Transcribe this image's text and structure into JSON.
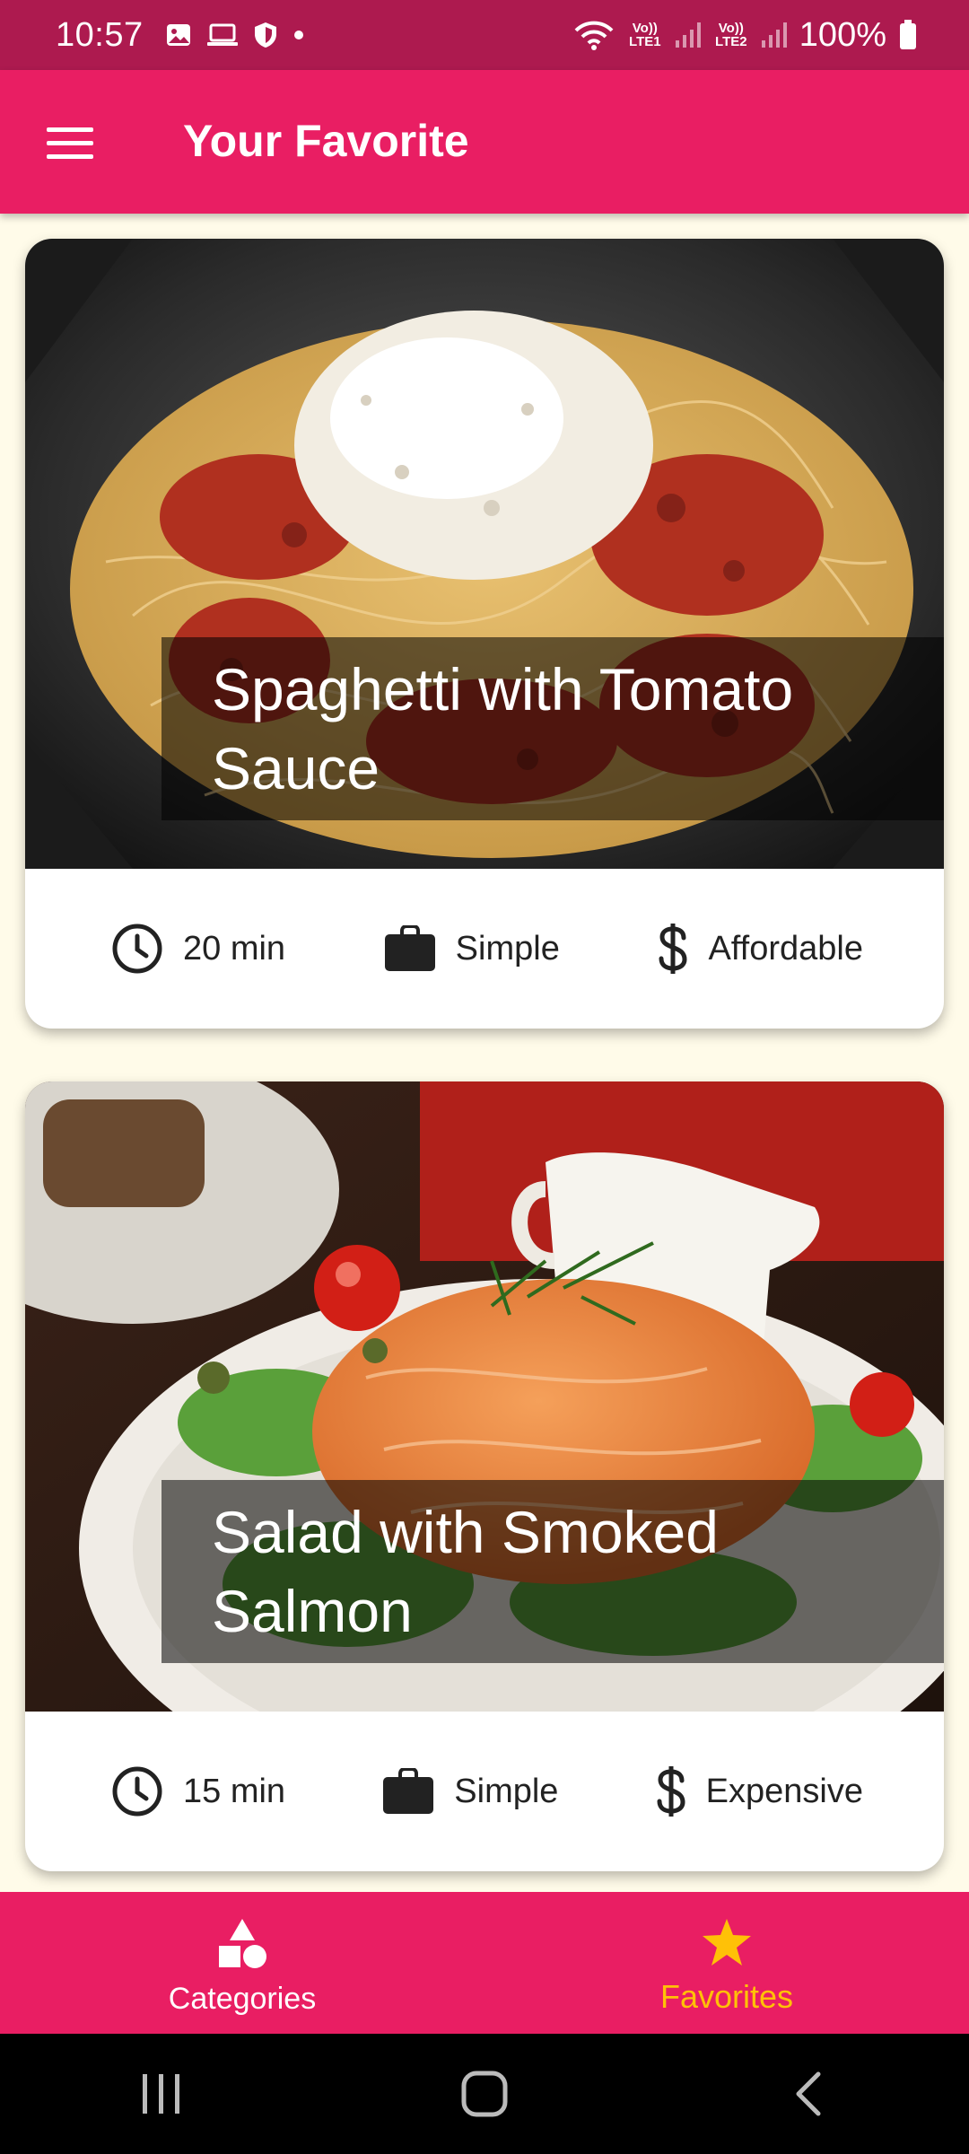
{
  "status_bar": {
    "time": "10:57",
    "battery": "100%",
    "sim1": "Vo)) LTE1",
    "sim2": "Vo)) LTE2"
  },
  "app_bar": {
    "title": "Your Favorite"
  },
  "meals": [
    {
      "title": "Spaghetti with Tomato Sauce",
      "duration": "20 min",
      "complexity": "Simple",
      "affordability": "Affordable"
    },
    {
      "title": "Salad with Smoked Salmon",
      "duration": "15 min",
      "complexity": "Simple",
      "affordability": "Expensive"
    }
  ],
  "bottom_nav": {
    "categories_label": "Categories",
    "favorites_label": "Favorites",
    "active_tab": "Favorites"
  },
  "colors": {
    "primary": "#e91e63",
    "status_bar": "#ad1a4f",
    "accent": "#ffc107",
    "background": "#fffbe9"
  }
}
